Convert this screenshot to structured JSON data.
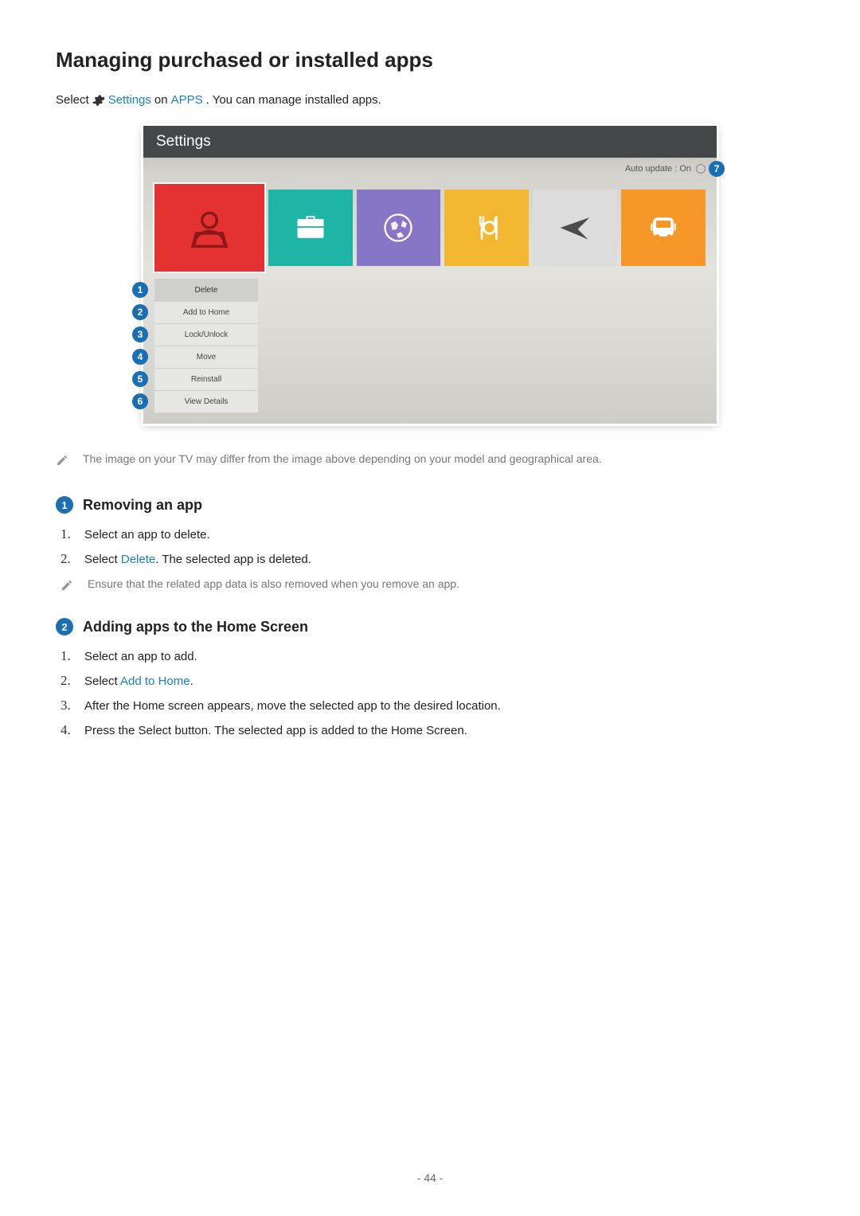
{
  "title": "Managing purchased or installed apps",
  "intro": {
    "pre": "Select",
    "settings_word": "Settings",
    "mid": "on",
    "apps_word": "APPS",
    "post": ". You can manage installed apps."
  },
  "tv": {
    "title": "Settings",
    "auto_update": "Auto update : On",
    "menu": [
      "Delete",
      "Add to Home",
      "Lock/Unlock",
      "Move",
      "Reinstall",
      "View Details"
    ]
  },
  "callouts": [
    "1",
    "2",
    "3",
    "4",
    "5",
    "6",
    "7"
  ],
  "note1": "The image on your TV may differ from the image above depending on your model and geographical area.",
  "section1": {
    "num": "1",
    "title": "Removing an app",
    "steps": [
      {
        "n": "1.",
        "text": "Select an app to delete."
      },
      {
        "n": "2.",
        "pre": "Select ",
        "link": "Delete",
        "post": ". The selected app is deleted."
      }
    ],
    "note": "Ensure that the related app data is also removed when you remove an app."
  },
  "section2": {
    "num": "2",
    "title": "Adding apps to the Home Screen",
    "steps": [
      {
        "n": "1.",
        "text": "Select an app to add."
      },
      {
        "n": "2.",
        "pre": "Select ",
        "link": "Add to Home",
        "post": "."
      },
      {
        "n": "3.",
        "text": "After the Home screen appears, move the selected app to the desired location."
      },
      {
        "n": "4.",
        "text": "Press the Select button. The selected app is added to the Home Screen."
      }
    ]
  },
  "page_number": "- 44 -"
}
